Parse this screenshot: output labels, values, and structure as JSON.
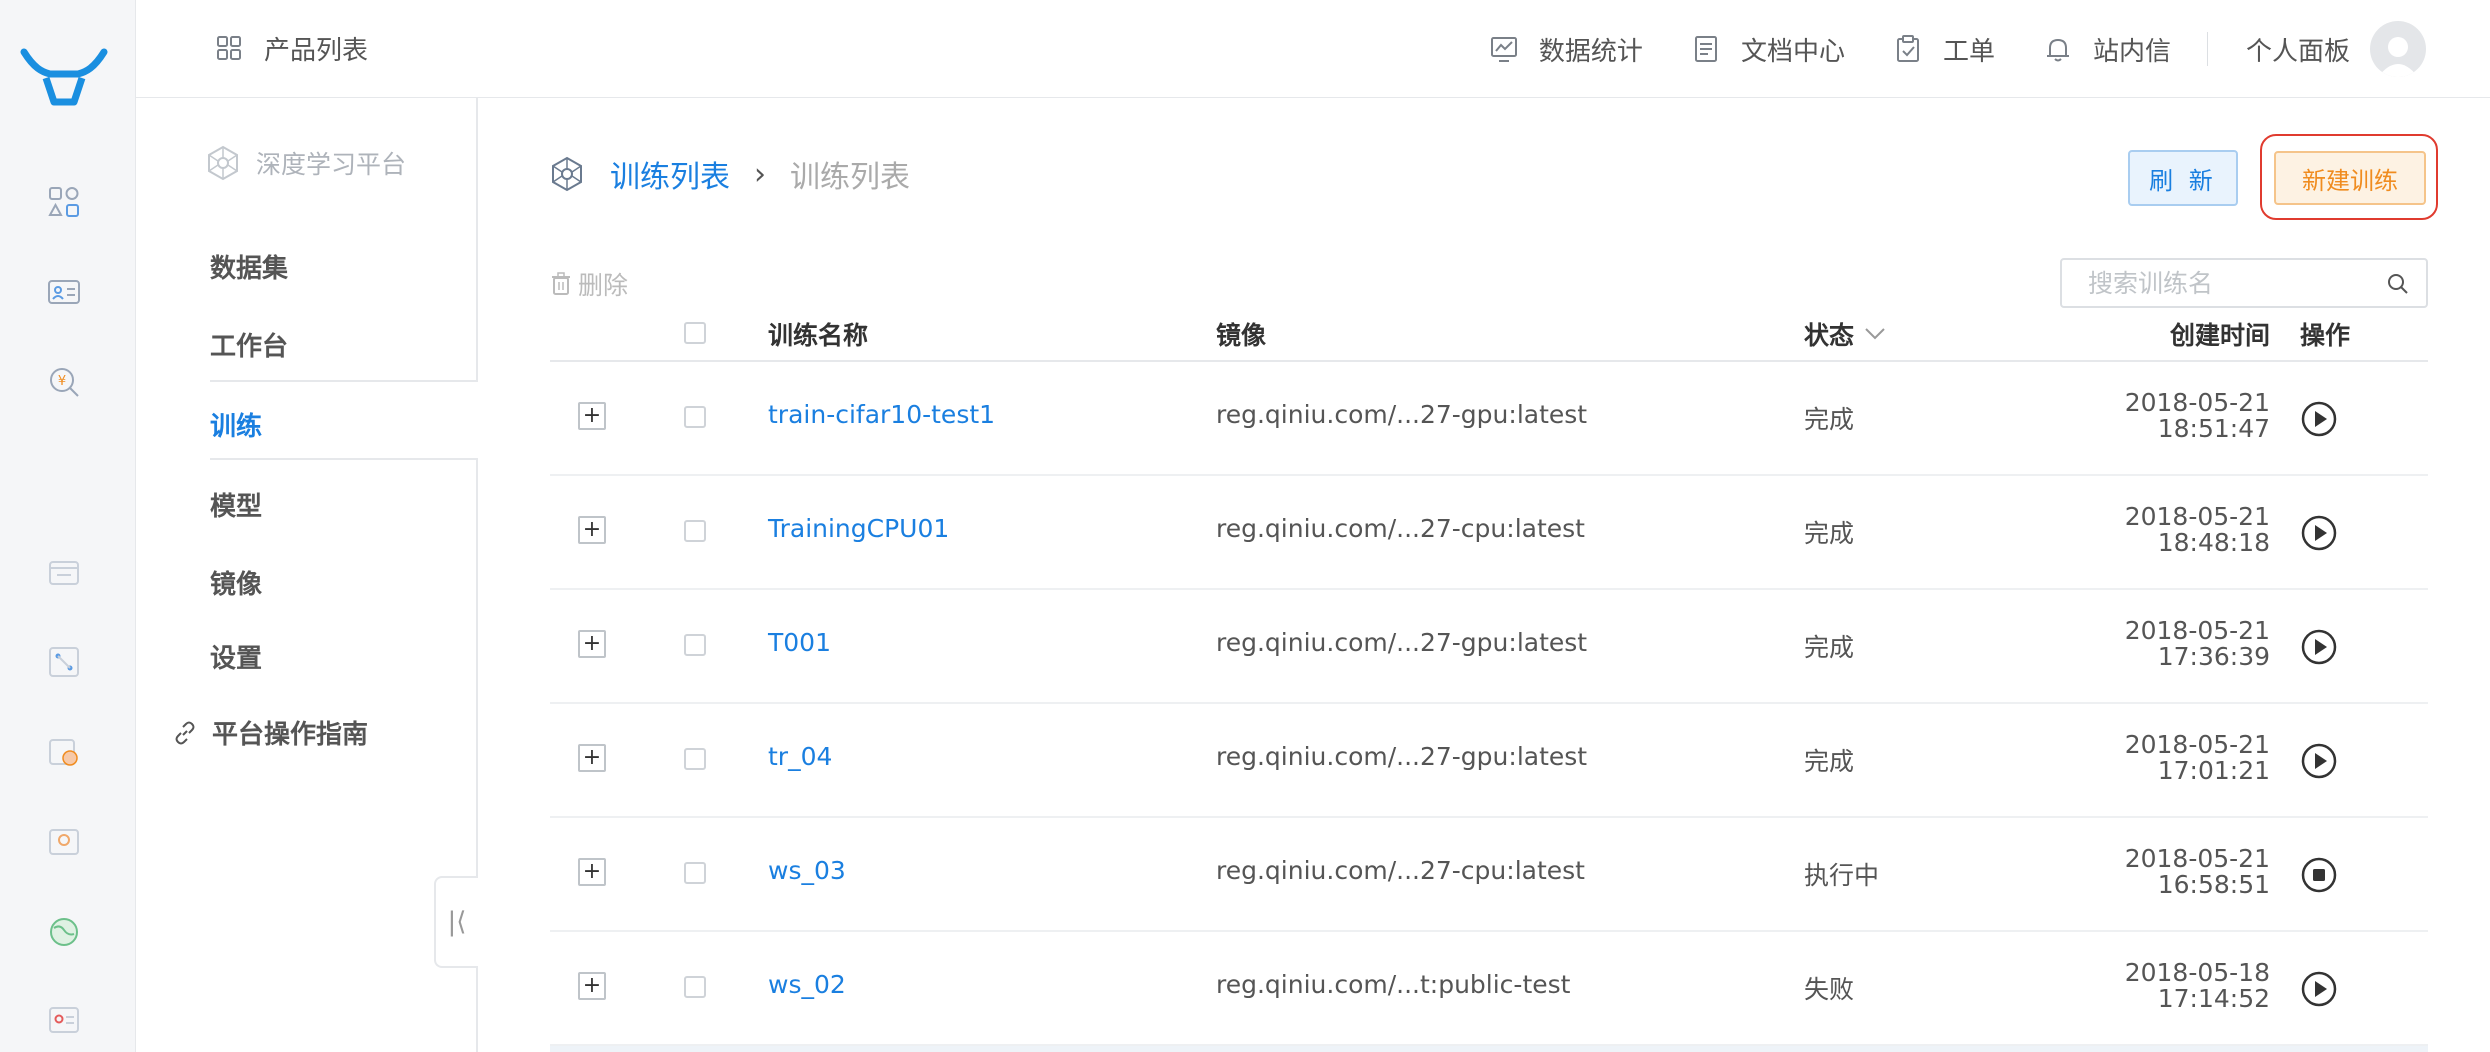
{
  "topbar": {
    "product_list": "产品列表",
    "nav": [
      {
        "label": "数据统计",
        "icon": "chart-icon"
      },
      {
        "label": "文档中心",
        "icon": "document-icon"
      },
      {
        "label": "工单",
        "icon": "clipboard-icon"
      },
      {
        "label": "站内信",
        "icon": "bell-icon"
      }
    ],
    "profile": "个人面板"
  },
  "sidebar": {
    "platform": "深度学习平台",
    "items": [
      {
        "label": "数据集"
      },
      {
        "label": "工作台"
      },
      {
        "label": "训练"
      },
      {
        "label": "模型"
      },
      {
        "label": "镜像"
      },
      {
        "label": "设置"
      }
    ],
    "active": "训练",
    "guide": "平台操作指南"
  },
  "main": {
    "breadcrumb": [
      "训练列表",
      "训练列表"
    ],
    "refresh_label": "刷 新",
    "new_label": "新建训练",
    "delete_label": "删除",
    "search_placeholder": "搜索训练名",
    "columns": {
      "name": "训练名称",
      "image": "镜像",
      "status": "状态",
      "created": "创建时间",
      "action": "操作"
    },
    "rows": [
      {
        "name": "train-cifar10-test1",
        "image": "reg.qiniu.com/...27-gpu:latest",
        "status": "完成",
        "date": "2018-05-21",
        "time": "18:51:47",
        "action": "play"
      },
      {
        "name": "TrainingCPU01",
        "image": "reg.qiniu.com/...27-cpu:latest",
        "status": "完成",
        "date": "2018-05-21",
        "time": "18:48:18",
        "action": "play"
      },
      {
        "name": "T001",
        "image": "reg.qiniu.com/...27-gpu:latest",
        "status": "完成",
        "date": "2018-05-21",
        "time": "17:36:39",
        "action": "play"
      },
      {
        "name": "tr_04",
        "image": "reg.qiniu.com/...27-gpu:latest",
        "status": "完成",
        "date": "2018-05-21",
        "time": "17:01:21",
        "action": "play"
      },
      {
        "name": "ws_03",
        "image": "reg.qiniu.com/...27-cpu:latest",
        "status": "执行中",
        "date": "2018-05-21",
        "time": "16:58:51",
        "action": "stop"
      },
      {
        "name": "ws_02",
        "image": "reg.qiniu.com/...t:public-test",
        "status": "失败",
        "date": "2018-05-18",
        "time": "17:14:52",
        "action": "play"
      }
    ]
  },
  "colors": {
    "accent": "#1a7fe0",
    "warning": "#f08c1f",
    "highlight": "#e03b2f"
  }
}
